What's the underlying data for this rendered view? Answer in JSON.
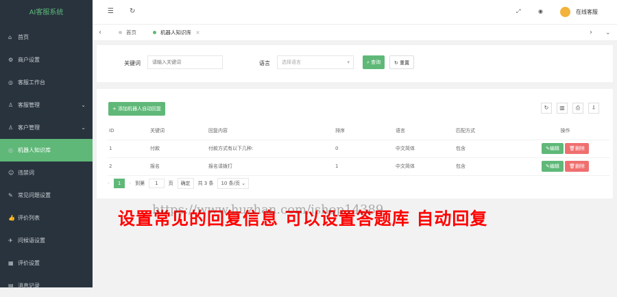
{
  "app_title": "AI客服系统",
  "sidebar": [
    {
      "label": "首页",
      "icon": "⌂"
    },
    {
      "label": "商户设置",
      "icon": "⚙"
    },
    {
      "label": "客服工作台",
      "icon": "◎"
    },
    {
      "label": "客服管理",
      "icon": "♙",
      "arrow": "⌄"
    },
    {
      "label": "客户管理",
      "icon": "♙",
      "arrow": "⌄"
    },
    {
      "label": "机器人知识库",
      "icon": "◎",
      "active": true
    },
    {
      "label": "违禁词",
      "icon": "☺"
    },
    {
      "label": "常见问题设置",
      "icon": "✎"
    },
    {
      "label": "评价列表",
      "icon": "👍"
    },
    {
      "label": "问候语设置",
      "icon": "✈"
    },
    {
      "label": "评价设置",
      "icon": "▦"
    },
    {
      "label": "消息记录",
      "icon": "▤"
    }
  ],
  "topbar": {
    "user": "在线客服"
  },
  "tabs": [
    {
      "label": "首页"
    },
    {
      "label": "机器人知识库"
    }
  ],
  "search": {
    "keyword_label": "关键词",
    "keyword_placeholder": "请输入关键词",
    "lang_label": "语言",
    "lang_placeholder": "选择语言",
    "query": "查询",
    "reset": "重置"
  },
  "add_button": "+ 添加机器人自动回复",
  "table": {
    "headers": [
      "ID",
      "关键词",
      "回复内容",
      "排序",
      "语言",
      "匹配方式",
      "操作"
    ],
    "rows": [
      [
        "1",
        "付款",
        "付款方式有以下几种:",
        "0",
        "中文简体",
        "包含"
      ],
      [
        "2",
        "报名",
        "报名请拨打",
        "1",
        "中文简体",
        "包含"
      ]
    ],
    "edit": "编辑",
    "delete": "删除"
  },
  "pagination": {
    "page": "1",
    "goto": "到第",
    "page_input": "1",
    "page_unit": "页",
    "confirm": "确定",
    "total": "共 3 条",
    "per_page": "10 条/页"
  },
  "overlay": "设置常见的回复信息 可以设置答题库 自动回复",
  "watermark": "https://www.huzhan.com/ishop14389"
}
